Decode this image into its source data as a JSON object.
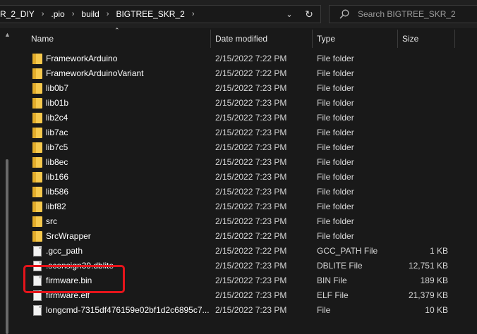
{
  "address": {
    "crumbs": [
      "R_2_DIY",
      ".pio",
      "build",
      "BIGTREE_SKR_2"
    ],
    "separator": "›",
    "dropdown_icon": "chevron-down",
    "refresh_icon": "refresh"
  },
  "search": {
    "placeholder": "Search BIGTREE_SKR_2"
  },
  "columns": {
    "name": "Name",
    "date": "Date modified",
    "type": "Type",
    "size": "Size"
  },
  "files": [
    {
      "icon": "folder",
      "name": "FrameworkArduino",
      "date": "2/15/2022 7:22 PM",
      "type": "File folder",
      "size": ""
    },
    {
      "icon": "folder",
      "name": "FrameworkArduinoVariant",
      "date": "2/15/2022 7:22 PM",
      "type": "File folder",
      "size": ""
    },
    {
      "icon": "folder",
      "name": "lib0b7",
      "date": "2/15/2022 7:23 PM",
      "type": "File folder",
      "size": ""
    },
    {
      "icon": "folder",
      "name": "lib01b",
      "date": "2/15/2022 7:23 PM",
      "type": "File folder",
      "size": ""
    },
    {
      "icon": "folder",
      "name": "lib2c4",
      "date": "2/15/2022 7:23 PM",
      "type": "File folder",
      "size": ""
    },
    {
      "icon": "folder",
      "name": "lib7ac",
      "date": "2/15/2022 7:23 PM",
      "type": "File folder",
      "size": ""
    },
    {
      "icon": "folder",
      "name": "lib7c5",
      "date": "2/15/2022 7:23 PM",
      "type": "File folder",
      "size": ""
    },
    {
      "icon": "folder",
      "name": "lib8ec",
      "date": "2/15/2022 7:23 PM",
      "type": "File folder",
      "size": ""
    },
    {
      "icon": "folder",
      "name": "lib166",
      "date": "2/15/2022 7:23 PM",
      "type": "File folder",
      "size": ""
    },
    {
      "icon": "folder",
      "name": "lib586",
      "date": "2/15/2022 7:23 PM",
      "type": "File folder",
      "size": ""
    },
    {
      "icon": "folder",
      "name": "libf82",
      "date": "2/15/2022 7:23 PM",
      "type": "File folder",
      "size": ""
    },
    {
      "icon": "folder",
      "name": "src",
      "date": "2/15/2022 7:23 PM",
      "type": "File folder",
      "size": ""
    },
    {
      "icon": "folder",
      "name": "SrcWrapper",
      "date": "2/15/2022 7:22 PM",
      "type": "File folder",
      "size": ""
    },
    {
      "icon": "file",
      "name": ".gcc_path",
      "date": "2/15/2022 7:22 PM",
      "type": "GCC_PATH File",
      "size": "1 KB"
    },
    {
      "icon": "file",
      "name": ".sconsign39.dblite",
      "date": "2/15/2022 7:23 PM",
      "type": "DBLITE File",
      "size": "12,751 KB"
    },
    {
      "icon": "file",
      "name": "firmware.bin",
      "date": "2/15/2022 7:23 PM",
      "type": "BIN File",
      "size": "189 KB"
    },
    {
      "icon": "file",
      "name": "firmware.elf",
      "date": "2/15/2022 7:23 PM",
      "type": "ELF File",
      "size": "21,379 KB"
    },
    {
      "icon": "file",
      "name": "longcmd-7315df476159e02bf1d2c6895c7...",
      "date": "2/15/2022 7:23 PM",
      "type": "File",
      "size": "10 KB"
    }
  ],
  "colors": {
    "highlight": "#e5141b",
    "folder": "#f6c94d",
    "background": "#191919"
  }
}
